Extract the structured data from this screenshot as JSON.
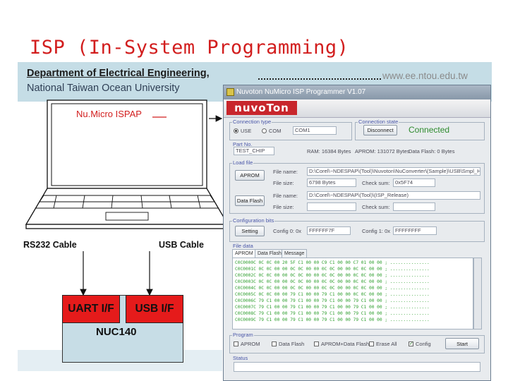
{
  "slide": {
    "title": "ISP (In-System Programming)",
    "department": "Department of Electrical Engineering,",
    "university": "National Taiwan Ocean University",
    "website": "www.ee.ntou.edu.tw"
  },
  "diagram": {
    "tool_label": "Nu.Micro ISPAP",
    "rs232_label": "RS232 Cable",
    "usb_label": "USB Cable",
    "uart_label": "UART I/F",
    "usbif_label": "USB I/F",
    "chip_label": "NUC140"
  },
  "app": {
    "window_title": "Nuvoton NuMicro ISP Programmer V1.07",
    "logo_text": "nuvoTon",
    "connection_type": {
      "label": "Connection type",
      "options": [
        "USE",
        "COM"
      ],
      "selected": "USE",
      "port": "COM1"
    },
    "connection_state": {
      "label": "Connection state",
      "disconnect_button": "Disconnect",
      "status": "Connected",
      "status_color": "#2e8b2e"
    },
    "part_no": {
      "label": "Part No.",
      "value": "TEST_CHIP"
    },
    "memory_info": {
      "ram": "RAM: 16384 Bytes",
      "aprom": "APROM: 131072 Bytes",
      "dataflash": "Data Flash: 0 Bytes"
    },
    "load_file": {
      "label": "Load file",
      "aprom_button": "APROM",
      "dataflash_button": "Data Flash",
      "filename_label": "File name:",
      "filesize_label": "File size:",
      "checksum_label": "Check sum:",
      "aprom_filename": "D:\\Corel\\~NDESPAP\\(Tool)\\Nuvoton\\NuConverter\\(Sample)\\USB\\Smpl_HID.bin",
      "aprom_filesize": "6798 Bytes",
      "aprom_checksum": "0x5F74",
      "dataflash_filename": "D:\\Corel\\~NDESPAP\\(Tool)\\(ISP_Release)",
      "dataflash_filesize": "",
      "dataflash_checksum": ""
    },
    "config": {
      "label": "Configuration bits",
      "setting_button": "Setting",
      "config0_label": "Config 0: 0x",
      "config0_value": "FFFFFF7F",
      "config1_label": "Config 1: 0x",
      "config1_value": "FFFFFFFF"
    },
    "tabs": {
      "group_label": "File data",
      "items": [
        "APROM",
        "Data Flash",
        "Message"
      ],
      "active": "APROM"
    },
    "hex_rows": [
      "C0C0000C  0C 0C 00 20 5F C1 00 00 C9 C1 00 00 C7 01 00 00  ; ...............",
      "C0C0001C  0C 0C 00 00 0C 0C 00 00 0C 0C 00 00 0C 0C 00 00  ; ...............",
      "C0C0002C  0C 0C 00 00 0C 0C 00 00 0C 0C 00 00 0C 0C 00 00  ; ...............",
      "C0C0003C  0C 0C 00 00 0C 0C 00 00 0C 0C 00 00 0C 0C 00 00  ; ...............",
      "C0C0004C  0C 0C 00 00 0C 0C 00 00 0C 0C 00 00 0C 0C 00 00  ; ...............",
      "C0C0005C  0C 0C 00 00 79 C1 00 00 79 C1 00 00 0C 0C 00 00  ; ...............",
      "C0C0006C  79 C1 00 00 79 C1 00 00 79 C1 00 00 79 C1 00 00  ; ...............",
      "C0C0007C  79 C1 00 00 79 C1 00 00 79 C1 00 00 79 C1 00 00  ; ...............",
      "C0C0008C  79 C1 00 00 79 C1 00 00 79 C1 00 00 79 C1 00 00  ; ...............",
      "C0C0009C  79 C1 00 00 79 C1 00 00 79 C1 00 00 79 C1 00 00  ; ..............."
    ],
    "program": {
      "label": "Program",
      "options": [
        "APROM",
        "Data Flash",
        "APROM+Data Flash",
        "Erase All",
        "Config"
      ],
      "checked": [
        "Config"
      ],
      "start_button": "Start"
    },
    "status_group_label": "Status"
  }
}
